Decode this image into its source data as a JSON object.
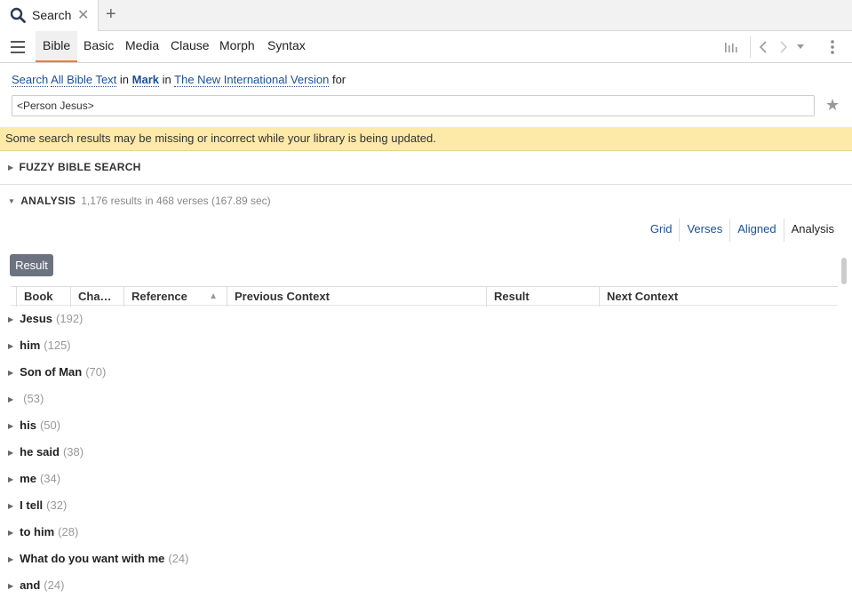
{
  "tab": {
    "title": "Search",
    "close": "✕",
    "new": "+"
  },
  "toolbar": {
    "tabs": [
      {
        "label": "Bible"
      },
      {
        "label": "Basic"
      },
      {
        "label": "Media"
      },
      {
        "label": "Clause"
      },
      {
        "label": "Morph"
      },
      {
        "label": "Syntax"
      }
    ],
    "active_tab": "Bible",
    "accent_color": "#e87d3e"
  },
  "search": {
    "word_search": "Search",
    "scope": "All Bible Text",
    "in1": "in",
    "range": "Mark",
    "in2": "in",
    "resource": "The New International Version",
    "for": "for",
    "query": "<Person Jesus>"
  },
  "warning": "Some search results may be missing or incorrect while your library is being updated.",
  "sections": {
    "fuzzy": "FUZZY BIBLE SEARCH",
    "analysis": "ANALYSIS",
    "analysis_meta": "1,176 results in 468 verses (167.89 sec)"
  },
  "views": [
    "Grid",
    "Verses",
    "Aligned",
    "Analysis"
  ],
  "active_view": "Analysis",
  "result_button": "Result",
  "columns": [
    "Book",
    "Cha…",
    "Reference",
    "Previous Context",
    "Result",
    "Next Context"
  ],
  "rows": [
    {
      "label": "Jesus",
      "count": "(192)"
    },
    {
      "label": "him",
      "count": "(125)"
    },
    {
      "label": "Son of Man",
      "count": "(70)"
    },
    {
      "label": "",
      "count": "(53)"
    },
    {
      "label": "his",
      "count": "(50)"
    },
    {
      "label": "he said",
      "count": "(38)"
    },
    {
      "label": "me",
      "count": "(34)"
    },
    {
      "label": "I tell",
      "count": "(32)"
    },
    {
      "label": "to him",
      "count": "(28)"
    },
    {
      "label": "What do you want with me",
      "count": "(24)"
    },
    {
      "label": "and",
      "count": "(24)"
    }
  ]
}
